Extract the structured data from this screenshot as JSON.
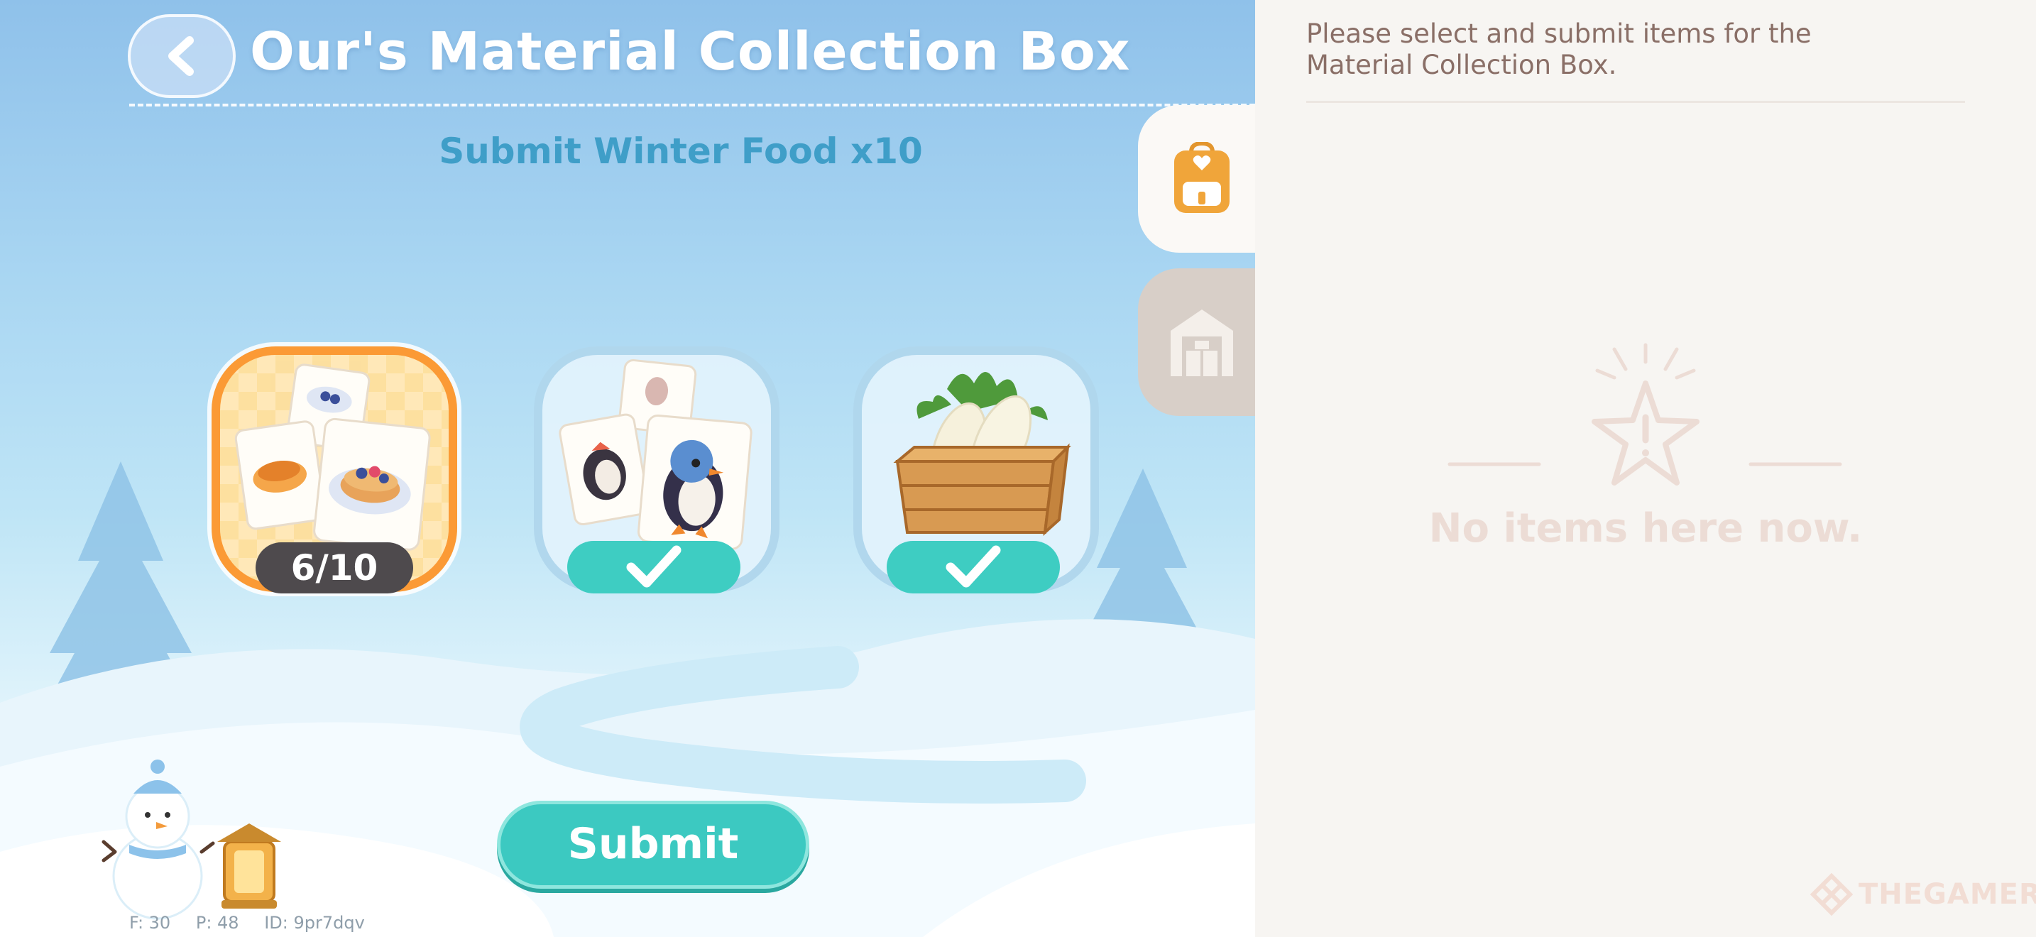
{
  "header": {
    "title": "Our's Material Collection Box",
    "back_icon": "chevron-left-icon"
  },
  "task": {
    "label": "Submit Winter Food x10"
  },
  "slots": [
    {
      "name": "Winter Food (pancakes)",
      "progress": "6/10",
      "selected": true,
      "complete": false
    },
    {
      "name": "Penguin figurines",
      "complete": true,
      "check_icon": "check-icon"
    },
    {
      "name": "Crate of radishes",
      "complete": true,
      "check_icon": "check-icon"
    }
  ],
  "actions": {
    "submit_label": "Submit"
  },
  "debug": {
    "f": "F: 30",
    "p": "P: 48",
    "id": "ID: 9pr7dqv"
  },
  "side_tabs": [
    {
      "icon": "backpack-icon",
      "active": true
    },
    {
      "icon": "warehouse-icon",
      "active": false
    }
  ],
  "panel": {
    "hint": "Please select and submit items for the Material Collection Box.",
    "empty_icon": "star-alert-icon",
    "empty_text": "No items here now."
  },
  "watermark": {
    "text": "THEGAMER"
  },
  "colors": {
    "accent_teal": "#3ecdc2",
    "selected_orange": "#fb9a35",
    "panel_bg": "#f7f5f2",
    "hint_text": "#8a6f67"
  }
}
